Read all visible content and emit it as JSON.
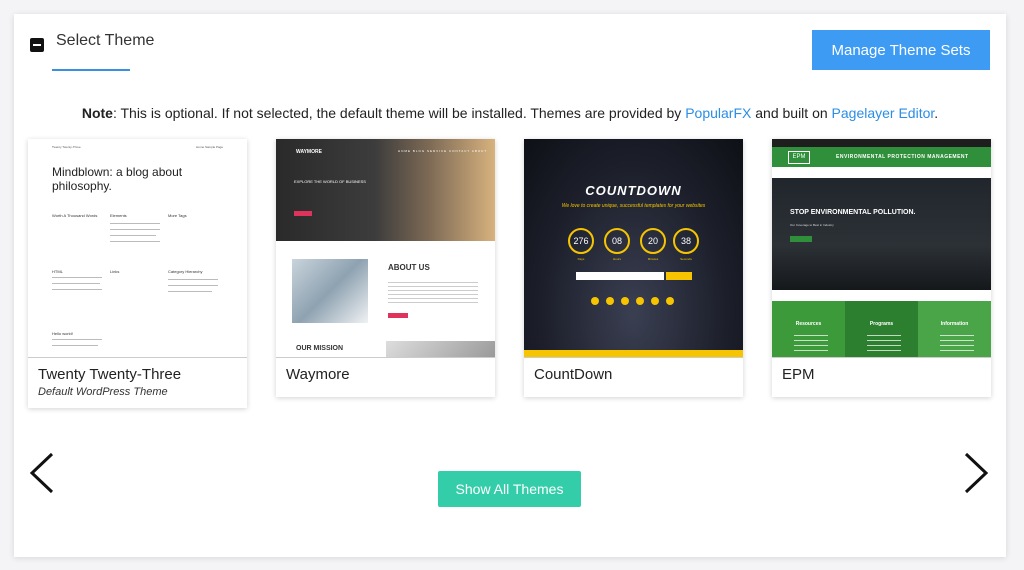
{
  "header": {
    "title": "Select Theme",
    "manage_label": "Manage Theme Sets"
  },
  "note": {
    "label": "Note",
    "text": ": This is optional. If not selected, the default theme will be installed. Themes are provided by ",
    "link1": "PopularFX",
    "middle": " and built on ",
    "link2": "Pagelayer Editor",
    "end": "."
  },
  "themes": [
    {
      "name": "Twenty Twenty-Three",
      "subtitle": "Default WordPress Theme",
      "preview": {
        "site_title": "Twenty Twenty-Three",
        "nav": "Home   Sample Page",
        "headline": "Mindblown: a blog about philosophy.",
        "posts": [
          "Worth A Thousand Words",
          "Elements",
          "More Tags",
          "HTML",
          "Links",
          "Category Hierarchy",
          "Hello world!"
        ]
      }
    },
    {
      "name": "Waymore",
      "preview": {
        "logo": "WAYMORE",
        "nav": "HOME  BLOG  SERVICE  CONTACT  ABOUT",
        "hero_text": "EXPLORE THE WORLD OF BUSINESS",
        "about": "ABOUT US",
        "mission": "OUR MISSION"
      }
    },
    {
      "name": "CountDown",
      "preview": {
        "title": "COUNTDOWN",
        "tagline": "We love to create unique, successful templates for your websites",
        "timer": [
          {
            "value": "276",
            "label": "Days"
          },
          {
            "value": "08",
            "label": "Hours"
          },
          {
            "value": "20",
            "label": "Minutes"
          },
          {
            "value": "38",
            "label": "Seconds"
          }
        ]
      }
    },
    {
      "name": "EPM",
      "preview": {
        "logo": "EPM",
        "title": "ENVIRONMENTAL PROTECTION MANAGEMENT",
        "headline": "STOP ENVIRONMENTAL POLLUTION.",
        "subline": "Our Coverage to Best in Industry",
        "tiles": [
          "Resources",
          "Programs",
          "Information"
        ]
      }
    }
  ],
  "show_all_label": "Show All Themes",
  "colors": {
    "primary_button": "#3d9bf4",
    "show_all_button": "#34cda9",
    "link": "#2a8ee6"
  }
}
